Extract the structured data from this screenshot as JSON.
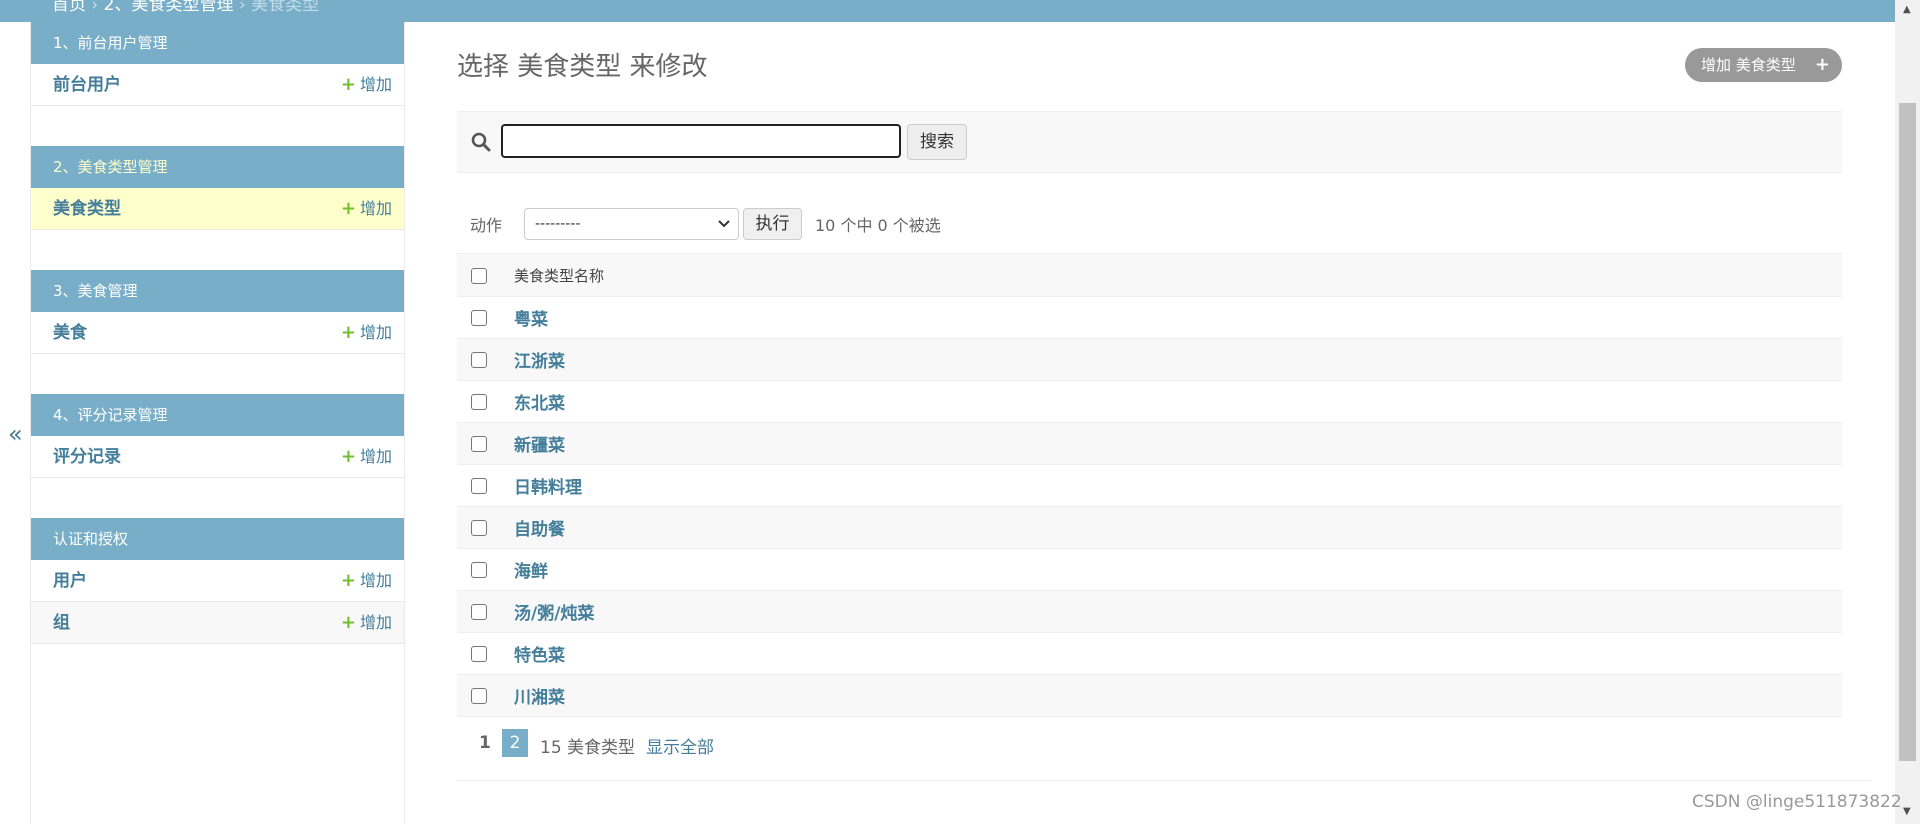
{
  "breadcrumb": {
    "home": "首页",
    "section": "2、美食类型管理",
    "current": "美食类型",
    "separator": "›"
  },
  "sidebar": {
    "toggle": "«",
    "add_label": "增加",
    "modules": [
      {
        "title": "1、前台用户管理",
        "items": [
          {
            "name": "前台用户"
          }
        ]
      },
      {
        "title": "2、美食类型管理",
        "items": [
          {
            "name": "美食类型"
          }
        ]
      },
      {
        "title": "3、美食管理",
        "items": [
          {
            "name": "美食"
          }
        ]
      },
      {
        "title": "4、评分记录管理",
        "items": [
          {
            "name": "评分记录"
          }
        ]
      },
      {
        "title": "认证和授权",
        "items": [
          {
            "name": "用户"
          },
          {
            "name": "组"
          }
        ]
      }
    ]
  },
  "main": {
    "title": "选择 美食类型 来修改",
    "add_button": "增加 美食类型",
    "search_value": "",
    "search_button": "搜索",
    "action_label": "动作",
    "action_selected": "---------",
    "go_button": "执行",
    "selection_counter": "10 个中 0 个被选",
    "column_header": "美食类型名称",
    "rows": [
      "粤菜",
      "江浙菜",
      "东北菜",
      "新疆菜",
      "日韩料理",
      "自助餐",
      "海鲜",
      "汤/粥/炖菜",
      "特色菜",
      "川湘菜"
    ],
    "pagination": {
      "page1": "1",
      "page2": "2",
      "count": "15 美食类型",
      "show_all": "显示全部"
    }
  },
  "watermark": "CSDN @linge511873822",
  "colors": {
    "header_bg": "#79aec8",
    "link": "#447e9b",
    "add_plus": "#70bf2b",
    "active_row": "#ffffcc"
  }
}
